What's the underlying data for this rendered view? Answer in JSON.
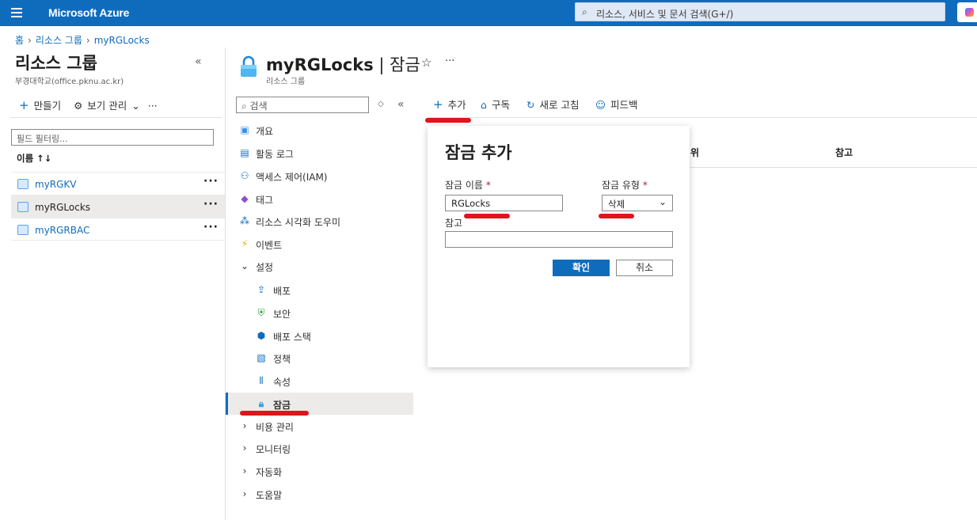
{
  "topbar": {
    "brand": "Microsoft Azure",
    "search_placeholder": "리소스, 서비스 및 문서 검색(G+/)"
  },
  "breadcrumb": [
    "홈",
    "리소스 그룹",
    "myRGLocks"
  ],
  "left_panel": {
    "title": "리소스 그룹",
    "subtitle": "부경대학교(office.pknu.ac.kr)",
    "toolbar": {
      "create": "만들기",
      "manage_view": "보기 관리"
    },
    "filter_placeholder": "필드 필터링...",
    "column_name": "이름 ↑↓",
    "items": [
      {
        "label": "myRGKV"
      },
      {
        "label": "myRGLocks"
      },
      {
        "label": "myRGRBAC"
      }
    ]
  },
  "resource": {
    "title": "myRGLocks",
    "title_section": "잠금",
    "subtitle": "리소스 그룹"
  },
  "menu": {
    "search_placeholder": "검색",
    "items": [
      {
        "label": "개요",
        "icon": "resource-group-icon"
      },
      {
        "label": "활동 로그",
        "icon": "activity-log-icon"
      },
      {
        "label": "액세스 제어(IAM)",
        "icon": "iam-icon"
      },
      {
        "label": "태그",
        "icon": "tag-icon"
      },
      {
        "label": "리소스 시각화 도우미",
        "icon": "visualizer-icon"
      },
      {
        "label": "이벤트",
        "icon": "lightning-icon"
      },
      {
        "label": "설정",
        "icon": "chevron-down-icon"
      },
      {
        "label": "배포",
        "icon": "upload-icon"
      },
      {
        "label": "보안",
        "icon": "shield-icon"
      },
      {
        "label": "배포 스택",
        "icon": "cube-icon"
      },
      {
        "label": "정책",
        "icon": "policy-icon"
      },
      {
        "label": "속성",
        "icon": "properties-icon"
      },
      {
        "label": "잠금",
        "icon": "lock-icon"
      },
      {
        "label": "비용 관리",
        "icon": "chevron-right-icon"
      },
      {
        "label": "모니터링",
        "icon": "chevron-right-icon"
      },
      {
        "label": "자동화",
        "icon": "chevron-right-icon"
      },
      {
        "label": "도움말",
        "icon": "chevron-right-icon"
      }
    ]
  },
  "commands": {
    "add": "추가",
    "subscription": "구독",
    "refresh": "새로 고침",
    "feedback": "피드백"
  },
  "grid": {
    "col_scope": "위",
    "col_notes": "참고"
  },
  "dialog": {
    "title": "잠금 추가",
    "lock_name_label": "잠금 이름",
    "lock_name_value": "RGLocks",
    "lock_type_label": "잠금 유형",
    "lock_type_value": "삭제",
    "notes_label": "참고",
    "notes_value": "",
    "required_mark": "*",
    "ok": "확인",
    "cancel": "취소"
  },
  "colors": {
    "brand": "#0f6cbd",
    "annotation": "#e3131b"
  }
}
